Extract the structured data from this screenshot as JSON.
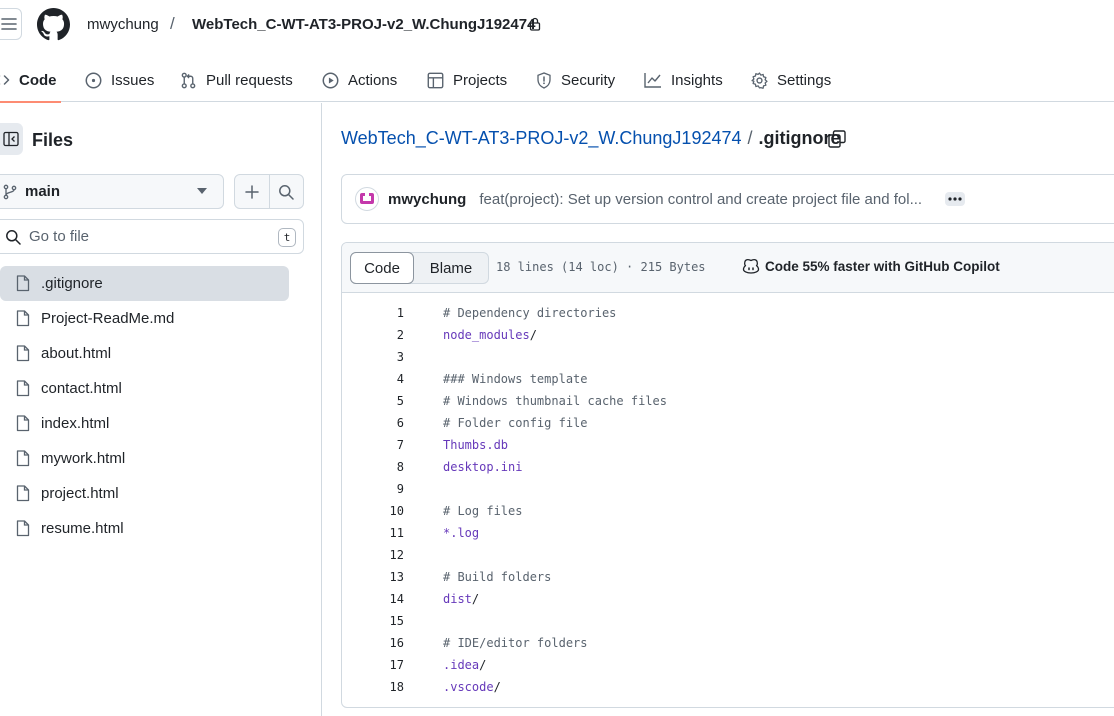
{
  "header": {
    "owner": "mwychung",
    "separator": "/",
    "repo": "WebTech_C-WT-AT3-PROJ-v2_W.ChungJ192474"
  },
  "tabs": [
    {
      "label": "Code",
      "icon": "code-icon",
      "active": true
    },
    {
      "label": "Issues",
      "icon": "issue-opened-icon"
    },
    {
      "label": "Pull requests",
      "icon": "git-pull-request-icon"
    },
    {
      "label": "Actions",
      "icon": "play-icon"
    },
    {
      "label": "Projects",
      "icon": "table-icon"
    },
    {
      "label": "Security",
      "icon": "shield-icon"
    },
    {
      "label": "Insights",
      "icon": "graph-icon"
    },
    {
      "label": "Settings",
      "icon": "gear-icon"
    }
  ],
  "sidebar": {
    "title": "Files",
    "branch": "main",
    "goto_placeholder": "Go to file",
    "goto_shortcut": "t",
    "files": [
      {
        "name": ".gitignore",
        "selected": true
      },
      {
        "name": "Project-ReadMe.md"
      },
      {
        "name": "about.html"
      },
      {
        "name": "contact.html"
      },
      {
        "name": "index.html"
      },
      {
        "name": "mywork.html"
      },
      {
        "name": "project.html"
      },
      {
        "name": "resume.html"
      }
    ]
  },
  "breadcrumb": {
    "repo": "WebTech_C-WT-AT3-PROJ-v2_W.ChungJ192474",
    "separator": "/",
    "file": ".gitignore"
  },
  "commit": {
    "author": "mwychung",
    "message": "feat(project): Set up version control and create project file and fol..."
  },
  "file_view": {
    "tab_code": "Code",
    "tab_blame": "Blame",
    "meta": "18 lines (14 loc) · 215 Bytes",
    "copilot": "Code 55% faster with GitHub Copilot"
  },
  "code_lines": [
    {
      "n": "1",
      "text": "# Dependency directories",
      "kind": "comment"
    },
    {
      "n": "2",
      "text": "node_modules",
      "suffix": "/",
      "kind": "path"
    },
    {
      "n": "3",
      "text": "",
      "kind": "blank"
    },
    {
      "n": "4",
      "text": "### Windows template",
      "kind": "comment"
    },
    {
      "n": "5",
      "text": "# Windows thumbnail cache files",
      "kind": "comment"
    },
    {
      "n": "6",
      "text": "# Folder config file",
      "kind": "comment"
    },
    {
      "n": "7",
      "text": "Thumbs.db",
      "kind": "path"
    },
    {
      "n": "8",
      "text": "desktop.ini",
      "kind": "path"
    },
    {
      "n": "9",
      "text": "",
      "kind": "blank"
    },
    {
      "n": "10",
      "text": "# Log files",
      "kind": "comment"
    },
    {
      "n": "11",
      "text": "*.log",
      "kind": "path"
    },
    {
      "n": "12",
      "text": "",
      "kind": "blank"
    },
    {
      "n": "13",
      "text": "# Build folders",
      "kind": "comment"
    },
    {
      "n": "14",
      "text": "dist",
      "suffix": "/",
      "kind": "path"
    },
    {
      "n": "15",
      "text": "",
      "kind": "blank"
    },
    {
      "n": "16",
      "text": "# IDE/editor folders",
      "kind": "comment"
    },
    {
      "n": "17",
      "text": ".idea",
      "suffix": "/",
      "kind": "path"
    },
    {
      "n": "18",
      "text": ".vscode",
      "suffix": "/",
      "kind": "path"
    }
  ],
  "colors": {
    "accent_underline": "#fd8c73",
    "link": "#0550ae",
    "path_token": "#6639ba",
    "comment_token": "#59636e",
    "border": "#d1d9e0"
  }
}
